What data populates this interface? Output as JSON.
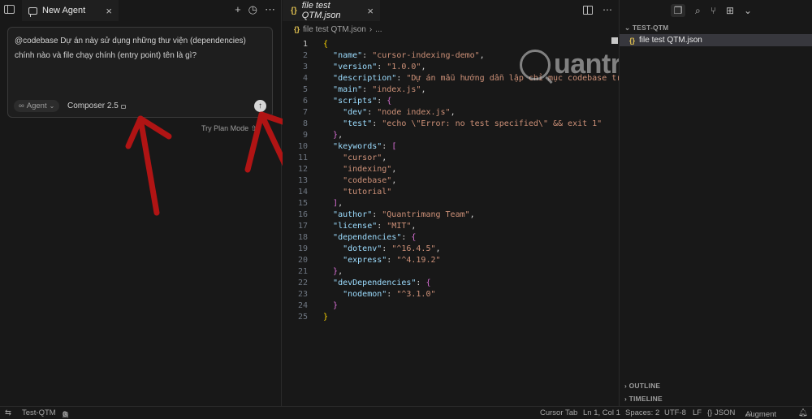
{
  "agent": {
    "tab_title": "New Agent",
    "prompt_text": "@codebase Dự án này sử dụng những thư viện (dependencies) chính nào và file chạy chính (entry point) tên là gì?",
    "mode_label": "Agent",
    "model_label": "Composer 2.5",
    "plan_mode_hint": "Try Plan Mode",
    "plan_mode_shortcut": "⇧T"
  },
  "editor": {
    "tab_title": "file test QTM.json",
    "breadcrumb_file": "file test QTM.json",
    "breadcrumb_more": "...",
    "active_line": 1,
    "lines": [
      [
        {
          "t": "{",
          "c": "b1"
        }
      ],
      [
        {
          "t": "  "
        },
        {
          "t": "\"name\"",
          "c": "k"
        },
        {
          "t": ": "
        },
        {
          "t": "\"cursor-indexing-demo\"",
          "c": "s"
        },
        {
          "t": ","
        }
      ],
      [
        {
          "t": "  "
        },
        {
          "t": "\"version\"",
          "c": "k"
        },
        {
          "t": ": "
        },
        {
          "t": "\"1.0.0\"",
          "c": "s"
        },
        {
          "t": ","
        }
      ],
      [
        {
          "t": "  "
        },
        {
          "t": "\"description\"",
          "c": "k"
        },
        {
          "t": ": "
        },
        {
          "t": "\"Dự án mẫu hướng dẫn lập chỉ mục codebase trên",
          "c": "s"
        }
      ],
      [
        {
          "t": "  "
        },
        {
          "t": "\"main\"",
          "c": "k"
        },
        {
          "t": ": "
        },
        {
          "t": "\"index.js\"",
          "c": "s"
        },
        {
          "t": ","
        }
      ],
      [
        {
          "t": "  "
        },
        {
          "t": "\"scripts\"",
          "c": "k"
        },
        {
          "t": ": "
        },
        {
          "t": "{",
          "c": "b2"
        }
      ],
      [
        {
          "t": "    "
        },
        {
          "t": "\"dev\"",
          "c": "k"
        },
        {
          "t": ": "
        },
        {
          "t": "\"node index.js\"",
          "c": "s"
        },
        {
          "t": ","
        }
      ],
      [
        {
          "t": "    "
        },
        {
          "t": "\"test\"",
          "c": "k"
        },
        {
          "t": ": "
        },
        {
          "t": "\"echo \\\"Error: no test specified\\\" && exit 1\"",
          "c": "s"
        }
      ],
      [
        {
          "t": "  "
        },
        {
          "t": "}",
          "c": "b2"
        },
        {
          "t": ","
        }
      ],
      [
        {
          "t": "  "
        },
        {
          "t": "\"keywords\"",
          "c": "k"
        },
        {
          "t": ": "
        },
        {
          "t": "[",
          "c": "b2"
        }
      ],
      [
        {
          "t": "    "
        },
        {
          "t": "\"cursor\"",
          "c": "s"
        },
        {
          "t": ","
        }
      ],
      [
        {
          "t": "    "
        },
        {
          "t": "\"indexing\"",
          "c": "s"
        },
        {
          "t": ","
        }
      ],
      [
        {
          "t": "    "
        },
        {
          "t": "\"codebase\"",
          "c": "s"
        },
        {
          "t": ","
        }
      ],
      [
        {
          "t": "    "
        },
        {
          "t": "\"tutorial\"",
          "c": "s"
        }
      ],
      [
        {
          "t": "  "
        },
        {
          "t": "]",
          "c": "b2"
        },
        {
          "t": ","
        }
      ],
      [
        {
          "t": "  "
        },
        {
          "t": "\"author\"",
          "c": "k"
        },
        {
          "t": ": "
        },
        {
          "t": "\"Quantrimang Team\"",
          "c": "s"
        },
        {
          "t": ","
        }
      ],
      [
        {
          "t": "  "
        },
        {
          "t": "\"license\"",
          "c": "k"
        },
        {
          "t": ": "
        },
        {
          "t": "\"MIT\"",
          "c": "s"
        },
        {
          "t": ","
        }
      ],
      [
        {
          "t": "  "
        },
        {
          "t": "\"dependencies\"",
          "c": "k"
        },
        {
          "t": ": "
        },
        {
          "t": "{",
          "c": "b2"
        }
      ],
      [
        {
          "t": "    "
        },
        {
          "t": "\"dotenv\"",
          "c": "k"
        },
        {
          "t": ": "
        },
        {
          "t": "\"^16.4.5\"",
          "c": "s"
        },
        {
          "t": ","
        }
      ],
      [
        {
          "t": "    "
        },
        {
          "t": "\"express\"",
          "c": "k"
        },
        {
          "t": ": "
        },
        {
          "t": "\"^4.19.2\"",
          "c": "s"
        }
      ],
      [
        {
          "t": "  "
        },
        {
          "t": "}",
          "c": "b2"
        },
        {
          "t": ","
        }
      ],
      [
        {
          "t": "  "
        },
        {
          "t": "\"devDependencies\"",
          "c": "k"
        },
        {
          "t": ": "
        },
        {
          "t": "{",
          "c": "b2"
        }
      ],
      [
        {
          "t": "    "
        },
        {
          "t": "\"nodemon\"",
          "c": "k"
        },
        {
          "t": ": "
        },
        {
          "t": "\"^3.1.0\"",
          "c": "s"
        }
      ],
      [
        {
          "t": "  "
        },
        {
          "t": "}",
          "c": "b2"
        }
      ],
      [
        {
          "t": "}",
          "c": "b1"
        }
      ]
    ]
  },
  "watermark": {
    "text": "uantrimang"
  },
  "explorer": {
    "folder_name": "TEST-QTM",
    "file_name": "file test QTM.json",
    "outline_label": "OUTLINE",
    "timeline_label": "TIMELINE"
  },
  "statusbar": {
    "remote_icon": "⇆",
    "workspace": "Test-QTM",
    "errors": "0",
    "warnings": "0",
    "cursor_tab": "Cursor Tab",
    "position": "Ln 1, Col 1",
    "spaces": "Spaces: 2",
    "encoding": "UTF-8",
    "eol": "LF",
    "language": "{} JSON",
    "augment": "Augment",
    "bell_icon": "bell-icon"
  },
  "colors": {
    "annotation_arrow": "#b01414",
    "string": "#ce9178",
    "key": "#9cdcfe",
    "bracket_outer": "#ffd700",
    "bracket_inner": "#da70d6"
  }
}
